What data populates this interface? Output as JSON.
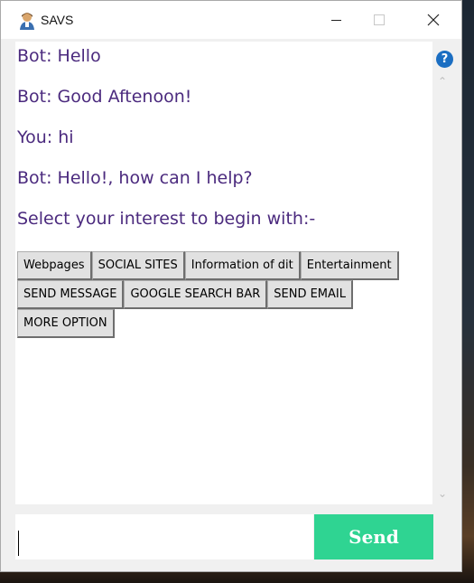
{
  "window": {
    "title": "SAVS"
  },
  "messages": [
    "Bot: Hello",
    "Bot: Good Aftenoon!",
    "You: hi",
    "Bot: Hello!, how can I help?",
    "Select your interest to begin with:-"
  ],
  "options": {
    "row1": [
      "Webpages",
      "SOCIAL SITES",
      "Information of dit",
      "Entertainment"
    ],
    "row2": [
      "SEND MESSAGE",
      "GOOGLE SEARCH BAR",
      "SEND EMAIL"
    ],
    "row3": [
      "MORE OPTION"
    ]
  },
  "input": {
    "value": ""
  },
  "send": {
    "label": "Send"
  },
  "colors": {
    "message_text": "#4b2a7e",
    "send_button": "#2fd492",
    "help_icon": "#1b6ec2"
  },
  "icons": [
    "user-avatar-icon",
    "minimize-icon",
    "maximize-icon",
    "close-icon",
    "help-icon",
    "scroll-up-icon",
    "scroll-down-icon"
  ]
}
